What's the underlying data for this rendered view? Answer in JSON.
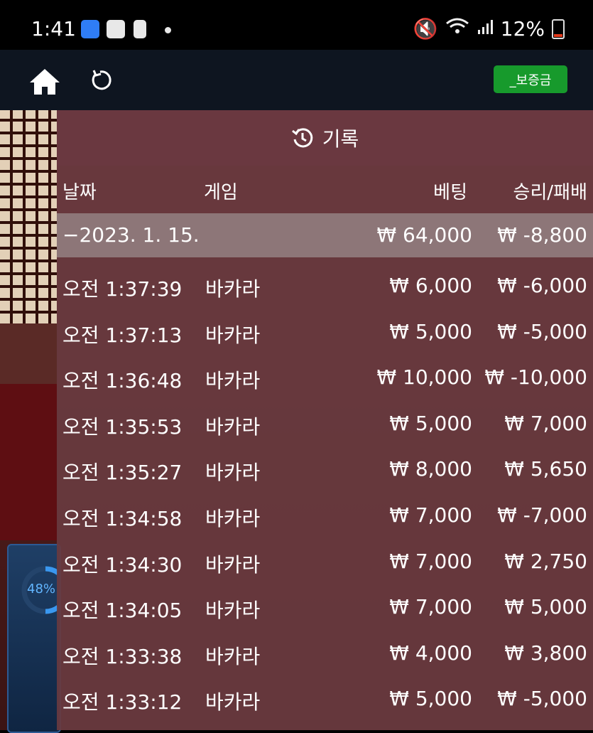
{
  "status_bar": {
    "time": "1:41",
    "battery": "12%"
  },
  "header": {
    "deposit_label": "_보증금"
  },
  "side_widget": {
    "percent": "48%"
  },
  "history": {
    "title": "기록",
    "columns": {
      "date": "날짜",
      "game": "게임",
      "bet": "베팅",
      "result": "승리/패배"
    },
    "date_group": {
      "date": "−2023. 1. 15.",
      "total_bet": "₩ 64,000",
      "total_result": "₩ -8,800"
    },
    "rows": [
      {
        "time": "오전 1:37:39",
        "game": "바카라",
        "bet": "₩ 6,000",
        "result": "₩ -6,000"
      },
      {
        "time": "오전 1:37:13",
        "game": "바카라",
        "bet": "₩ 5,000",
        "result": "₩ -5,000"
      },
      {
        "time": "오전 1:36:48",
        "game": "바카라",
        "bet": "₩ 10,000",
        "result": "₩ -10,000"
      },
      {
        "time": "오전 1:35:53",
        "game": "바카라",
        "bet": "₩ 5,000",
        "result": "₩ 7,000"
      },
      {
        "time": "오전 1:35:27",
        "game": "바카라",
        "bet": "₩ 8,000",
        "result": "₩ 5,650"
      },
      {
        "time": "오전 1:34:58",
        "game": "바카라",
        "bet": "₩ 7,000",
        "result": "₩ -7,000"
      },
      {
        "time": "오전 1:34:30",
        "game": "바카라",
        "bet": "₩ 7,000",
        "result": "₩ 2,750"
      },
      {
        "time": "오전 1:34:05",
        "game": "바카라",
        "bet": "₩ 7,000",
        "result": "₩ 5,000"
      },
      {
        "time": "오전 1:33:38",
        "game": "바카라",
        "bet": "₩ 4,000",
        "result": "₩ 3,800"
      },
      {
        "time": "오전 1:33:12",
        "game": "바카라",
        "bet": "₩ 5,000",
        "result": "₩ -5,000"
      }
    ]
  }
}
